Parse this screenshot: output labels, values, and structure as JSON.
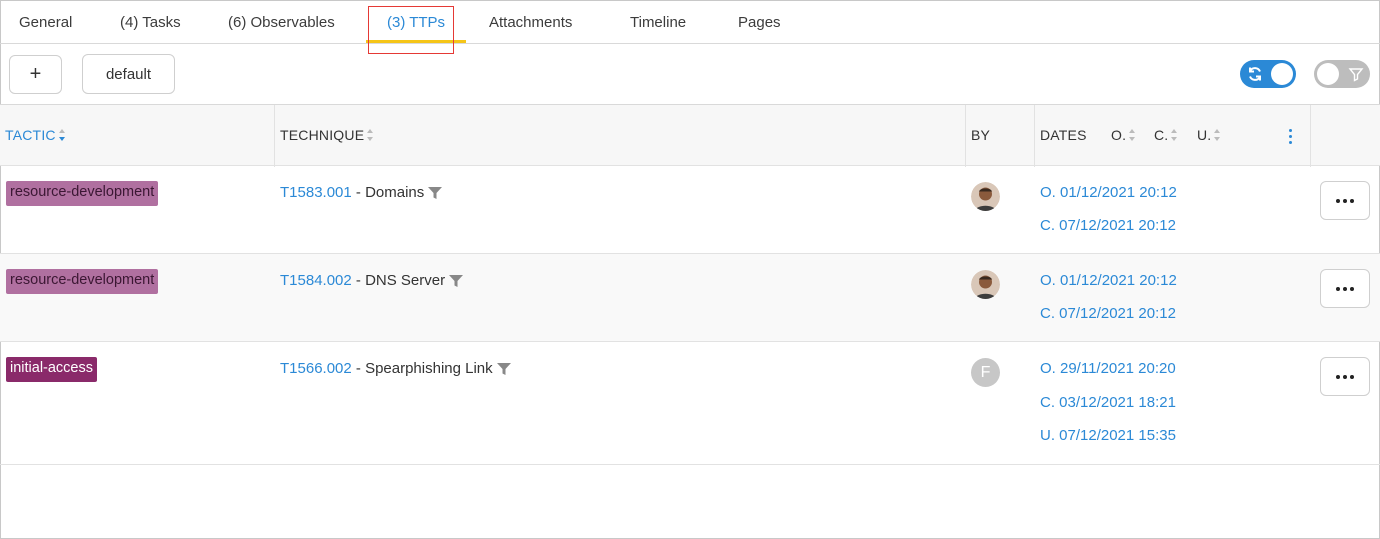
{
  "tabs": [
    {
      "label": "General"
    },
    {
      "label": "(4) Tasks"
    },
    {
      "label": "(6) Observables"
    },
    {
      "label": "(3) TTPs",
      "active": true
    },
    {
      "label": "Attachments"
    },
    {
      "label": "Timeline"
    },
    {
      "label": "Pages"
    }
  ],
  "toolbar": {
    "add_label": "+",
    "default_label": "default",
    "refresh_toggle_on": true,
    "filter_toggle_on": false
  },
  "table": {
    "columns": {
      "tactic": "TACTIC",
      "technique": "TECHNIQUE",
      "by": "BY",
      "dates": "DATES",
      "date_o": "O.",
      "date_c": "C.",
      "date_u": "U."
    },
    "rows": [
      {
        "tactic": "resource-development",
        "technique_id": "T1583.001",
        "technique_name": " - Domains",
        "by": "",
        "dates": [
          "O. 01/12/2021 20:12",
          "C. 07/12/2021 20:12"
        ]
      },
      {
        "tactic": "resource-development",
        "technique_id": "T1584.002",
        "technique_name": " - DNS Server",
        "by": "",
        "dates": [
          "O. 01/12/2021 20:12",
          "C. 07/12/2021 20:12"
        ]
      },
      {
        "tactic": "initial-access",
        "technique_id": "T1566.002",
        "technique_name": " - Spearphishing Link",
        "by": "F",
        "dates": [
          "O. 29/11/2021 20:20",
          "C. 03/12/2021 18:21",
          "U. 07/12/2021 15:35"
        ]
      }
    ]
  },
  "colors": {
    "accent": "#2b89d6",
    "tab_underline": "#f5c518",
    "tag_resource_development": "#b070a0",
    "tag_initial_access": "#8a2a6a"
  }
}
